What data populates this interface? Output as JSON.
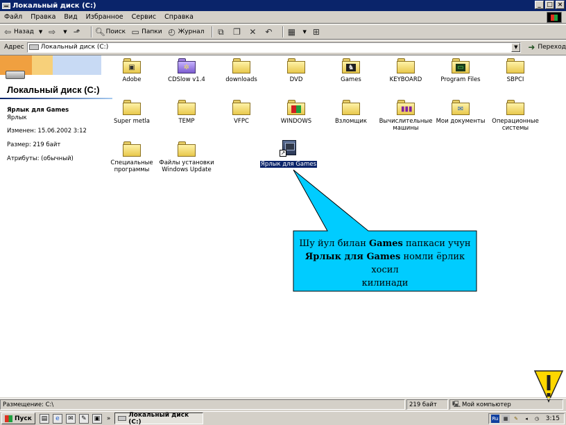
{
  "window": {
    "title": "Локальный диск (C:)",
    "buttons": [
      "_",
      "□",
      "×"
    ]
  },
  "menu": [
    "Файл",
    "Правка",
    "Вид",
    "Избранное",
    "Сервис",
    "Справка"
  ],
  "toolbar": {
    "back": "Назад",
    "search": "Поиск",
    "folders": "Папки",
    "history": "Журнал"
  },
  "address": {
    "label": "Адрес",
    "value": "Локальный диск (C:)",
    "go": "Переход"
  },
  "left_pane": {
    "title": "Локальный диск (C:)",
    "selected_name": "Ярлык для Games",
    "selected_type": "Ярлык",
    "modified": "Изменен: 15.06.2002 3:12",
    "size": "Размер: 219 байт",
    "attributes": "Атрибуты: (обычный)"
  },
  "items": [
    {
      "label": "Adobe",
      "icon": "folder-drive-icon"
    },
    {
      "label": "CDSlow v1.4",
      "icon": "purple-app-folder-icon"
    },
    {
      "label": "downloads",
      "icon": "folder-icon"
    },
    {
      "label": "DVD",
      "icon": "folder-icon"
    },
    {
      "label": "Games",
      "icon": "folder-games-icon"
    },
    {
      "label": "KEYBOARD",
      "icon": "folder-icon"
    },
    {
      "label": "Program Files",
      "icon": "folder-program-icon"
    },
    {
      "label": "SBPCI",
      "icon": "folder-icon"
    },
    {
      "label": "Super metla",
      "icon": "folder-icon"
    },
    {
      "label": "TEMP",
      "icon": "folder-icon"
    },
    {
      "label": "VFPC",
      "icon": "folder-icon"
    },
    {
      "label": "WINDOWS",
      "icon": "folder-windows-icon"
    },
    {
      "label": "Взломщик",
      "icon": "folder-icon"
    },
    {
      "label": "Вычислительные машины",
      "icon": "folder-chart-icon"
    },
    {
      "label": "Мои документы",
      "icon": "my-documents-icon"
    },
    {
      "label": "Операционные системы",
      "icon": "folder-icon"
    },
    {
      "label": "Специальные программы",
      "icon": "folder-icon"
    },
    {
      "label": "Файлы установки Windows Update",
      "icon": "folder-icon"
    },
    {
      "label": "Ярлык для Games",
      "icon": "shortcut-icon",
      "selected": true
    }
  ],
  "callout": {
    "line1_pre": "Шу йул билан ",
    "line1_bold": "Games",
    "line1_post": " папкаси учун",
    "line2_bold": "Ярлык для Games",
    "line2_post": " номли ёрлик хосил",
    "line3": "килинади",
    "fill_color": "#00ccff"
  },
  "status": {
    "placement": "Размещение: C:\\",
    "size": "219 байт",
    "location": "Мой компьютер"
  },
  "taskbar": {
    "start": "Пуск",
    "task": "Локальный диск (C:)",
    "lang": "Ru",
    "clock": "3:15"
  },
  "colors": {
    "titlebar": "#0a246a",
    "selection": "#0a246a",
    "warning": "#ffd700"
  }
}
